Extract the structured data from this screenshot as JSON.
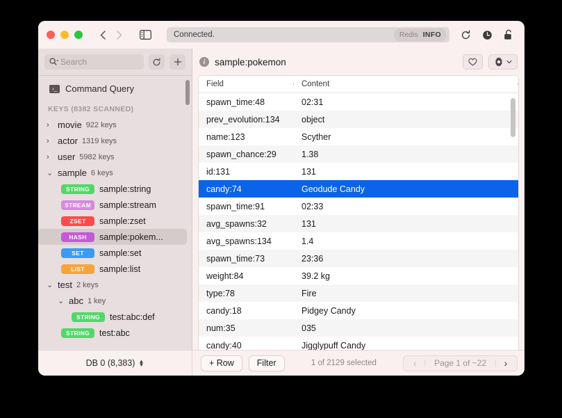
{
  "titlebar": {
    "status": "Connected.",
    "redis_label": "Redis",
    "info_label": "INFO",
    "back_icon": "chevron-left-icon",
    "forward_icon": "chevron-right-icon",
    "sidebar_toggle_icon": "sidebar-toggle-icon",
    "refresh_icon": "refresh-icon",
    "clock_icon": "clock-icon",
    "unlock_icon": "unlock-icon"
  },
  "sidebar": {
    "search": {
      "placeholder": "Search",
      "icon": "search-icon"
    },
    "refresh_icon": "refresh-icon",
    "add_icon": "plus-icon",
    "command_query": {
      "label": "Command Query",
      "icon": "terminal-icon"
    },
    "keys_header": "KEYS (8382 SCANNED)",
    "groups": [
      {
        "name": "movie",
        "count": "922 keys",
        "expanded": false
      },
      {
        "name": "actor",
        "count": "1319 keys",
        "expanded": false
      },
      {
        "name": "user",
        "count": "5982 keys",
        "expanded": false
      },
      {
        "name": "sample",
        "count": "6 keys",
        "expanded": true
      }
    ],
    "sample_keys": [
      {
        "type": "STRING",
        "name": "sample:string",
        "color": "#53d769",
        "selected": false
      },
      {
        "type": "STREAM",
        "name": "sample:stream",
        "color": "#d68ae0",
        "selected": false
      },
      {
        "type": "ZSET",
        "name": "sample:zset",
        "color": "#fc4b4b",
        "selected": false
      },
      {
        "type": "HASH",
        "name": "sample:pokem...",
        "color": "#c659d8",
        "selected": true
      },
      {
        "type": "SET",
        "name": "sample:set",
        "color": "#3a9bf5",
        "selected": false
      },
      {
        "type": "LIST",
        "name": "sample:list",
        "color": "#f7a53b",
        "selected": false
      }
    ],
    "test_group": {
      "name": "test",
      "count": "2 keys",
      "expanded": true
    },
    "abc_group": {
      "name": "abc",
      "count": "1 key",
      "expanded": true
    },
    "test_keys": [
      {
        "type": "STRING",
        "name": "test:abc:def",
        "color": "#53d769",
        "deep": true
      },
      {
        "type": "STRING",
        "name": "test:abc",
        "color": "#53d769",
        "deep": false
      }
    ]
  },
  "main": {
    "key_title": "sample:pokemon",
    "info_icon": "info-icon",
    "favorite_icon": "heart-icon",
    "settings_icon": "gear-icon",
    "settings_chevron_icon": "chevron-down-icon",
    "columns": [
      "Field",
      "Content"
    ],
    "rows": [
      {
        "field": "spawn_time:48",
        "content": "02:31",
        "selected": false
      },
      {
        "field": "prev_evolution:134",
        "content": "object",
        "selected": false
      },
      {
        "field": "name:123",
        "content": "Scyther",
        "selected": false
      },
      {
        "field": "spawn_chance:29",
        "content": "1.38",
        "selected": false
      },
      {
        "field": "id:131",
        "content": "131",
        "selected": false
      },
      {
        "field": "candy:74",
        "content": "Geodude Candy",
        "selected": true
      },
      {
        "field": "spawn_time:91",
        "content": "02:33",
        "selected": false
      },
      {
        "field": "avg_spawns:32",
        "content": "131",
        "selected": false
      },
      {
        "field": "avg_spawns:134",
        "content": "1.4",
        "selected": false
      },
      {
        "field": "spawn_time:73",
        "content": "23:36",
        "selected": false
      },
      {
        "field": "weight:84",
        "content": "39.2 kg",
        "selected": false
      },
      {
        "field": "type:78",
        "content": "Fire",
        "selected": false
      },
      {
        "field": "candy:18",
        "content": "Pidgey Candy",
        "selected": false
      },
      {
        "field": "num:35",
        "content": "035",
        "selected": false
      },
      {
        "field": "candy:40",
        "content": "Jigglypuff Candy",
        "selected": false
      }
    ]
  },
  "bottombar": {
    "db_label": "DB 0 (8,383)",
    "add_row_label": "+ Row",
    "filter_label": "Filter",
    "selection_status": "1 of 2129 selected",
    "page_label": "Page 1 of ~22",
    "prev_icon": "chevron-left-icon",
    "next_icon": "chevron-right-icon"
  }
}
